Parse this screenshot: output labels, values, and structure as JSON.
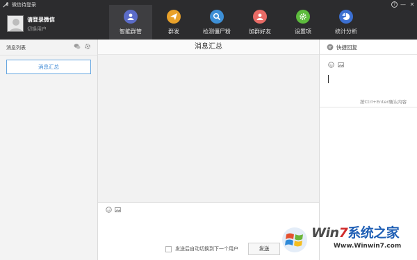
{
  "window": {
    "title": "微信待登录",
    "help": "?",
    "minimize": "—",
    "close": "✕"
  },
  "profile": {
    "name": "请登录微信",
    "switch": "切换用户"
  },
  "nav": [
    {
      "label": "智能群管",
      "icon": "group-manage-icon",
      "color": "#5b6cc9"
    },
    {
      "label": "群发",
      "icon": "paper-plane-icon",
      "color": "#e9a12a"
    },
    {
      "label": "检测僵尸粉",
      "icon": "detect-search-icon",
      "color": "#3d8fd6"
    },
    {
      "label": "加群好友",
      "icon": "add-friend-icon",
      "color": "#e96b66"
    },
    {
      "label": "设置项",
      "icon": "settings-gear-icon",
      "color": "#5dbb3d"
    },
    {
      "label": "统计分析",
      "icon": "pie-chart-icon",
      "color": "#3b6fd1"
    }
  ],
  "left": {
    "title": "消息列表",
    "summary_button": "消息汇总"
  },
  "center": {
    "title": "消息汇总",
    "auto_switch_label": "发送后自动切换到下一个用户",
    "send_button": "发送"
  },
  "right": {
    "title": "快捷回复",
    "hint": "按Ctrl+Enter确认内容"
  },
  "watermark": {
    "logo_w": "Win",
    "logo_num": "7",
    "logo_cn": "系统之家",
    "url": "Www.Winwin7.com"
  }
}
